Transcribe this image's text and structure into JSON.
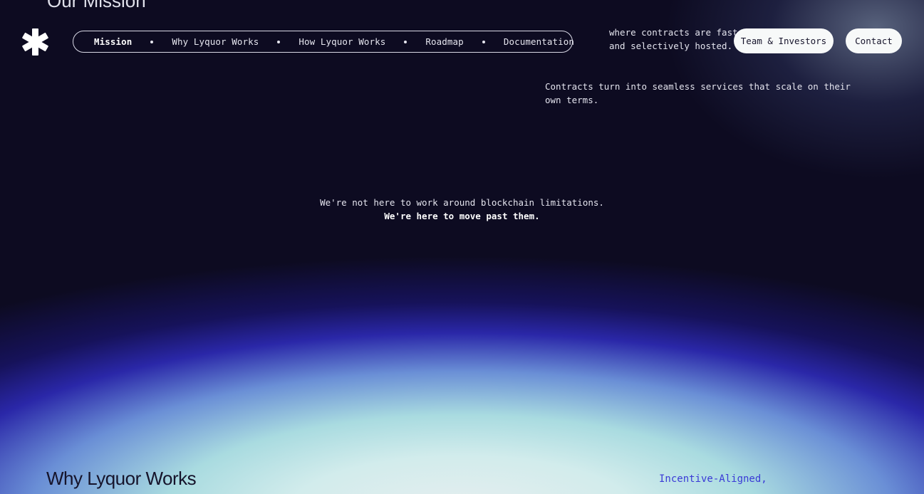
{
  "top_fragment": "Our Mission",
  "nav": {
    "items": [
      {
        "label": "Mission",
        "active": true
      },
      {
        "label": "Why Lyquor Works",
        "active": false
      },
      {
        "label": "How Lyquor Works",
        "active": false
      },
      {
        "label": "Roadmap",
        "active": false
      },
      {
        "label": "Documentation",
        "active": false
      }
    ]
  },
  "tagline": {
    "line1": "where contracts are fast",
    "line2": "and selectively hosted."
  },
  "header_buttons": {
    "team": "Team & Investors",
    "contact": "Contact"
  },
  "sub_tagline": "Contracts turn into seamless services that scale on their own terms.",
  "statement": {
    "line1": "We're not here to work around blockchain limitations.",
    "line2": "We're here to move past them."
  },
  "section": {
    "title": "Why Lyquor Works",
    "right_label": "Incentive-Aligned,"
  },
  "colors": {
    "background": "#0d0b21",
    "accent_blue": "#3a3ad6",
    "pill_bg": "#f7f9f9"
  },
  "icons": {
    "logo": "asterisk-logo-icon"
  }
}
